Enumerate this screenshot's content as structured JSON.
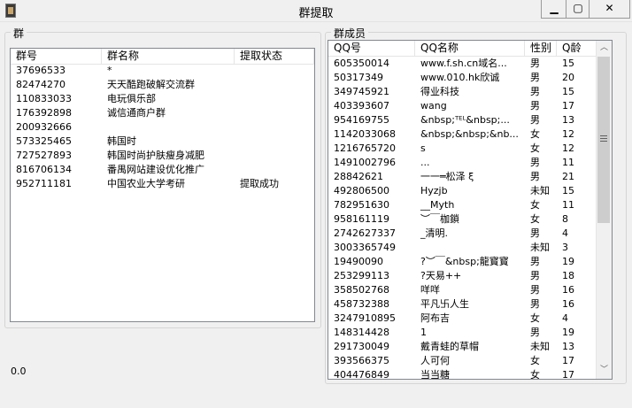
{
  "window": {
    "title": "群提取",
    "min_glyph": "▁",
    "max_glyph": "▢",
    "close_glyph": "✕"
  },
  "groups_box": {
    "label": "群",
    "columns": [
      "群号",
      "群名称",
      "提取状态"
    ],
    "rows": [
      [
        "37696533",
        "*",
        ""
      ],
      [
        "82474270",
        "天天酷跑破解交流群",
        ""
      ],
      [
        "110833033",
        "电玩俱乐部",
        ""
      ],
      [
        "176392898",
        "诚信通商户群",
        ""
      ],
      [
        "200932666",
        "",
        ""
      ],
      [
        "573325465",
        "韩国时",
        ""
      ],
      [
        "727527893",
        "韩国时尚护肤瘦身减肥",
        ""
      ],
      [
        "816706134",
        "番禺网站建设优化推广",
        ""
      ],
      [
        "952711181",
        "中国农业大学考研",
        "提取成功"
      ]
    ]
  },
  "members_box": {
    "label": "群成员",
    "columns": [
      "QQ号",
      "QQ名称",
      "性别",
      "Q龄"
    ],
    "rows": [
      [
        "605350014",
        "www.f.sh.cn域名...",
        "男",
        "15"
      ],
      [
        "50317349",
        "www.010.hk欣诚",
        "男",
        "20"
      ],
      [
        "349745921",
        "得业科技",
        "男",
        "15"
      ],
      [
        "403393607",
        "wang",
        "男",
        "17"
      ],
      [
        "954169755",
        "&nbsp;ᵀᴱᴸ&nbsp;...",
        "男",
        "13"
      ],
      [
        "1142033068",
        "&nbsp;&nbsp;&nb...",
        "女",
        "12"
      ],
      [
        "1216765720",
        "s",
        "女",
        "12"
      ],
      [
        "1491002796",
        "                   ...",
        "男",
        "11"
      ],
      [
        "28842621",
        "一一═松泽 ξ",
        "男",
        "21"
      ],
      [
        "492806500",
        "Hyzjb",
        "未知",
        "15"
      ],
      [
        "782951630",
        "__Myth",
        "女",
        "11"
      ],
      [
        "958161119",
        "︶￣枷鎖",
        "女",
        "8"
      ],
      [
        "2742627337",
        "_清明.",
        "男",
        "4"
      ],
      [
        "3003365749",
        "",
        "未知",
        "3"
      ],
      [
        "19490090",
        "?︶￣&nbsp;龍寳寳",
        "男",
        "19"
      ],
      [
        "253299113",
        "?天易++",
        "男",
        "18"
      ],
      [
        "358502768",
        "咩咩",
        "男",
        "16"
      ],
      [
        "458732388",
        "平凡卐人生",
        "男",
        "16"
      ],
      [
        "3247910895",
        "阿布吉",
        "女",
        "4"
      ],
      [
        "148314428",
        "1",
        "男",
        "19"
      ],
      [
        "291730049",
        "戴青蛙的草帽",
        "未知",
        "13"
      ],
      [
        "393566375",
        "人可何",
        "女",
        "17"
      ],
      [
        "404476849",
        "当当糖",
        "女",
        "17"
      ]
    ],
    "scroll_up": "︿",
    "scroll_down": "﹀"
  },
  "status_text": "0.0"
}
